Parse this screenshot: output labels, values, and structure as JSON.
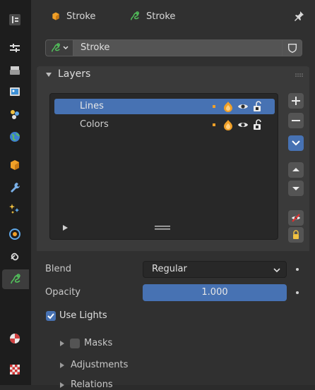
{
  "header": {
    "object_name": "Stroke",
    "data_name": "Stroke"
  },
  "datablock": {
    "name": "Stroke"
  },
  "layers": {
    "title": "Layers",
    "items": [
      {
        "name": "Lines",
        "selected": true
      },
      {
        "name": "Colors",
        "selected": false
      }
    ]
  },
  "properties": {
    "blend_label": "Blend",
    "blend_value": "Regular",
    "opacity_label": "Opacity",
    "opacity_value": "1.000",
    "use_lights_label": "Use Lights"
  },
  "subpanels": {
    "masks": "Masks",
    "adjustments": "Adjustments",
    "relations": "Relations"
  },
  "colors": {
    "accent": "#4772b3",
    "panel": "#303030",
    "tabbar": "#1d1d1d",
    "gp_green": "#52c15b",
    "object_orange": "#f0a028"
  }
}
